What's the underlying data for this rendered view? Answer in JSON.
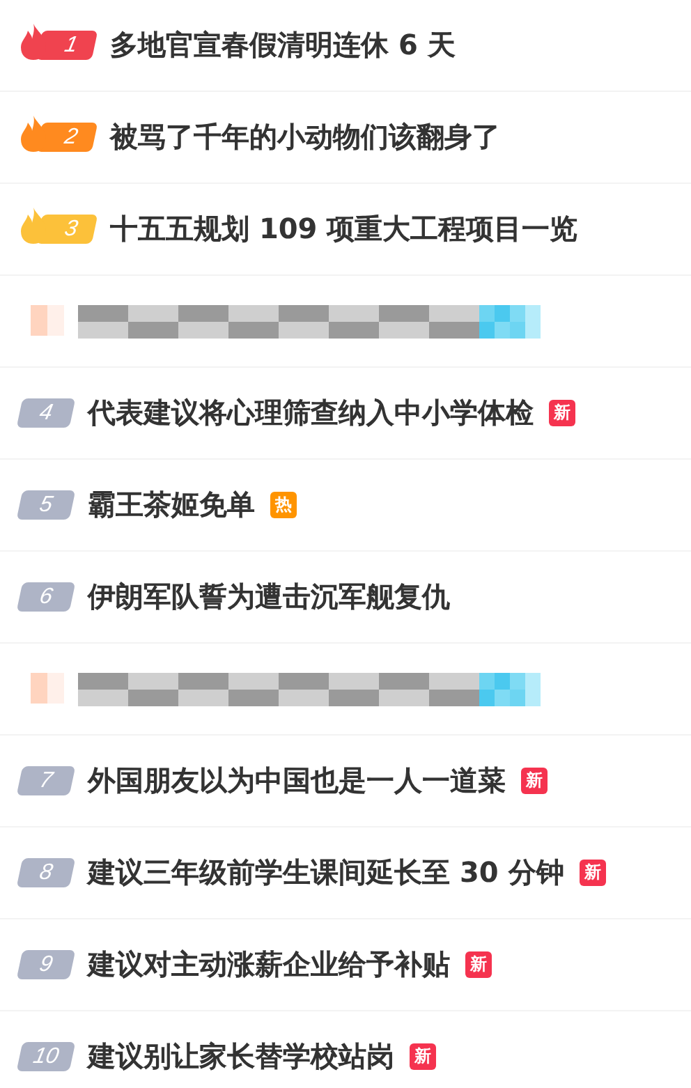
{
  "hot_list": [
    {
      "kind": "entry",
      "rank": "1",
      "flame": true,
      "color": "#f0434f",
      "title": "多地官宣春假清明连休 6 天"
    },
    {
      "kind": "entry",
      "rank": "2",
      "flame": true,
      "color": "#ff8a1f",
      "title": "被骂了千年的小动物们该翻身了"
    },
    {
      "kind": "entry",
      "rank": "3",
      "flame": true,
      "color": "#fcc13a",
      "title": "十五五规划 109 项重大工程项目一览"
    },
    {
      "kind": "blurred"
    },
    {
      "kind": "entry",
      "rank": "4",
      "flame": false,
      "color": "#aeb4c6",
      "title": "代表建议将心理筛查纳入中小学体检",
      "tag": {
        "text": "新",
        "color": "#f5334f"
      }
    },
    {
      "kind": "entry",
      "rank": "5",
      "flame": false,
      "color": "#aeb4c6",
      "title": "霸王茶姬免单",
      "tag": {
        "text": "热",
        "color": "#ff9400"
      }
    },
    {
      "kind": "entry",
      "rank": "6",
      "flame": false,
      "color": "#aeb4c6",
      "title": "伊朗军队誓为遭击沉军舰复仇"
    },
    {
      "kind": "blurred"
    },
    {
      "kind": "entry",
      "rank": "7",
      "flame": false,
      "color": "#aeb4c6",
      "title": "外国朋友以为中国也是一人一道菜",
      "tag": {
        "text": "新",
        "color": "#f5334f"
      }
    },
    {
      "kind": "entry",
      "rank": "8",
      "flame": false,
      "color": "#aeb4c6",
      "title": "建议三年级前学生课间延长至 30 分钟",
      "tag": {
        "text": "新",
        "color": "#f5334f"
      }
    },
    {
      "kind": "entry",
      "rank": "9",
      "flame": false,
      "color": "#aeb4c6",
      "title": "建议对主动涨薪企业给予补贴",
      "tag": {
        "text": "新",
        "color": "#f5334f"
      }
    },
    {
      "kind": "entry",
      "rank": "10",
      "flame": false,
      "color": "#aeb4c6",
      "title": "建议别让家长替学校站岗",
      "tag": {
        "text": "新",
        "color": "#f5334f"
      }
    }
  ]
}
